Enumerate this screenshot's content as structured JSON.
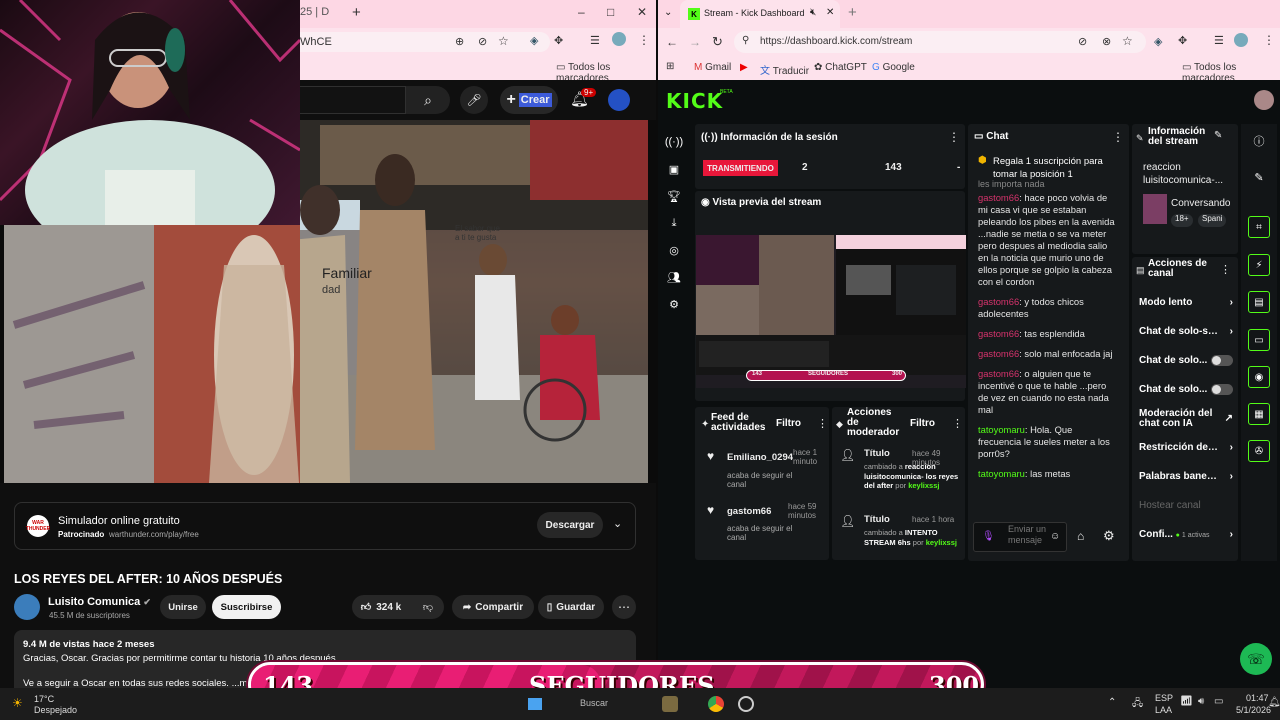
{
  "left_browser": {
    "tab_title": "25 | D",
    "new_tab": "+",
    "address": "WhCE",
    "bookmarks_label": "Todos los marcadores",
    "window": {
      "minimize": "–",
      "maximize": "□",
      "close": "✕"
    }
  },
  "youtube": {
    "create_label": "Crear",
    "notif_badge": "9+",
    "ad": {
      "logo": "WAR THUNDER",
      "title": "Simulador online gratuito",
      "sponsored": "Patrocinado",
      "domain": "warthunder.com/play/free",
      "cta": "Descargar"
    },
    "video_title": "LOS REYES DEL AFTER: 10 AÑOS DESPUÉS",
    "channel": {
      "name": "Luisito Comunica",
      "subs": "45.5 M de suscriptores",
      "join": "Unirse",
      "subscribe": "Suscribirse"
    },
    "likes": "324 k",
    "share": "Compartir",
    "save": "Guardar",
    "description": {
      "meta": "9.4 M de vistas  hace 2 meses",
      "line1": "Gracias, Oscar. Gracias por permitirme contar tu historia 10 años después.",
      "line2": "Ve a seguir a Oscar en todas sus redes sociales. ...más"
    },
    "video_signs": {
      "sign1": "Familiar",
      "sign2": "dad",
      "sign3": "El sabor que a ti te gusta"
    }
  },
  "right_browser": {
    "tab_title": "Stream - Kick Dashboard",
    "new_tab": "+",
    "url": "https://dashboard.kick.com/stream",
    "bookmarks": [
      "Gmail",
      "Traducir",
      "ChatGPT",
      "Google"
    ],
    "bookmarks_all": "Todos los marcadores"
  },
  "kick": {
    "logo": "KICK",
    "logo_beta": "BETA",
    "session": {
      "title": "Información de la sesión",
      "status": "TRANSMITIENDO",
      "viewers": "2",
      "followers": "143",
      "dash": "-"
    },
    "preview": {
      "title": "Vista previa del stream",
      "bar_left": "143",
      "bar_mid": "SEGUIDORES",
      "bar_right": "300"
    },
    "feed": {
      "title": "Feed de actividades",
      "filter": "Filtro",
      "items": [
        {
          "user": "Emiliano_0294",
          "time": "hace 1 minuto",
          "action": "acaba de seguir el canal"
        },
        {
          "user": "gastom66",
          "time": "hace 59 minutos",
          "action": "acaba de seguir el canal"
        }
      ]
    },
    "mod_actions": {
      "title": "Acciones de moderador",
      "filter": "Filtro",
      "items": [
        {
          "label": "Título",
          "time": "hace 49 minutos",
          "pre": "cambiado a ",
          "bold": "reaccion luisitocomunica- los reyes del after",
          "by": " por ",
          "user": "keylixssj"
        },
        {
          "label": "Título",
          "time": "hace 1 hora",
          "pre": "cambiado a ",
          "bold": "INTENTO STREAM 6hs",
          "by": " por ",
          "user": "keylixssj"
        }
      ]
    },
    "chat": {
      "title": "Chat",
      "pinned": "Regala 1 suscripción para tomar la posición 1",
      "partial": "les importa nada",
      "messages": [
        {
          "user": "gastom66",
          "text": ": hace poco volvia de mi casa vi que se estaban peleando los pibes en la avenida ...nadie se metia o se va meter pero despues al mediodia salio en la noticia que murio uno de ellos porque se golpio la cabeza con el cordon",
          "cls": "u1"
        },
        {
          "user": "gastom66",
          "text": ": y todos chicos adolecentes",
          "cls": "u1"
        },
        {
          "user": "gastom66",
          "text": ": tas esplendida",
          "cls": "u1"
        },
        {
          "user": "gastom66",
          "text": ": solo mal enfocada jaj",
          "cls": "u1"
        },
        {
          "user": "gastom66",
          "text": ": o alguien que te incentivé o que te hable ...pero de vez en cuando no esta nada mal",
          "cls": "u1"
        },
        {
          "user": "tatoyomaru",
          "text": ": Hola. Que frecuencia le sueles meter a los porr0s?",
          "cls": "u2"
        },
        {
          "user": "tatoyomaru",
          "text": ": las metas",
          "cls": "u2"
        }
      ],
      "input_placeholder": "Enviar un mensaje"
    },
    "stream_info": {
      "title": "Información del stream",
      "stream_title": "reaccion luisitocomunica-...",
      "category": "Conversando",
      "tag1": "18+",
      "tag2": "Spani"
    },
    "channel_actions": {
      "title": "Acciones de canal",
      "rows": [
        {
          "label": "Modo lento",
          "kind": "chev"
        },
        {
          "label": "Chat de solo-seg",
          "kind": "chev"
        },
        {
          "label": "Chat de solo...",
          "kind": "toggle"
        },
        {
          "label": "Chat de solo...",
          "kind": "toggle"
        },
        {
          "label": "Moderación del chat con IA",
          "kind": "ext"
        },
        {
          "label": "Restricción de ed",
          "kind": "chev"
        },
        {
          "label": "Palabras baneadi",
          "kind": "chev"
        },
        {
          "label": "Hostear canal",
          "kind": "disabled"
        },
        {
          "label": "Confi...",
          "kind": "chev",
          "extra": "1 activas"
        }
      ]
    }
  },
  "overlay": {
    "left": "143",
    "mid": "SEGUIDORES",
    "right": "300",
    "progress": 0.48
  },
  "taskbar": {
    "temp": "17°C",
    "weather": "Despejado",
    "search": "Buscar",
    "lang1": "ESP",
    "lang2": "LAA",
    "time": "01:47",
    "date": "5/1/2026"
  },
  "colors": {
    "kick_green": "#53fc18",
    "live_red": "#e8173a",
    "overlay_pink": "#e91e74"
  }
}
